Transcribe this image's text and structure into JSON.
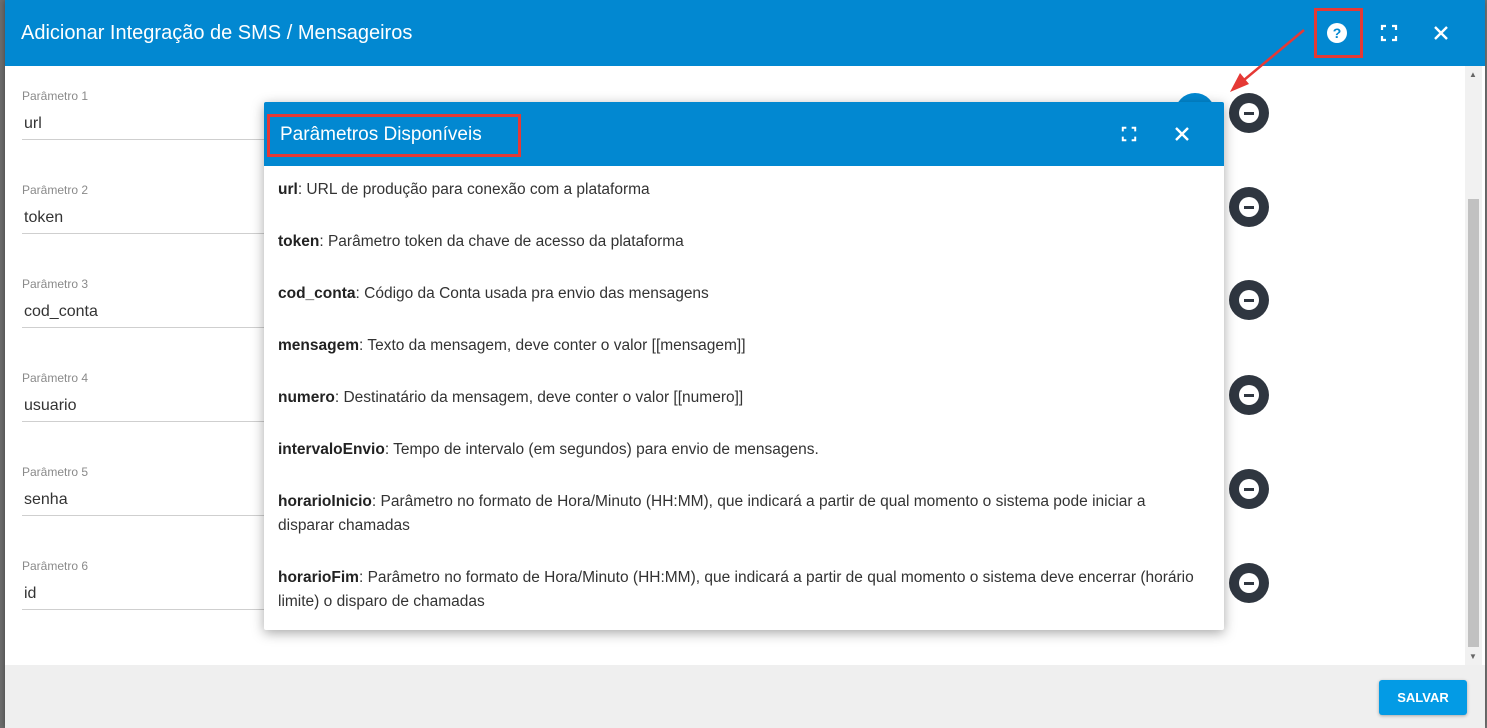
{
  "dialog": {
    "title": "Adicionar Integração de SMS / Mensageiros",
    "help_icon": "help-circle-icon",
    "maximize_icon": "fullscreen-icon",
    "close_icon": "close-icon"
  },
  "parameters": [
    {
      "label": "Parâmetro 1",
      "value": "url"
    },
    {
      "label": "Parâmetro 2",
      "value": "token"
    },
    {
      "label": "Parâmetro 3",
      "value": "cod_conta"
    },
    {
      "label": "Parâmetro 4",
      "value": "usuario"
    },
    {
      "label": "Parâmetro 5",
      "value": "senha"
    },
    {
      "label": "Parâmetro 6",
      "value": "id"
    }
  ],
  "remove_icon": "minus-circle-icon",
  "footer": {
    "save_label": "SALVAR"
  },
  "popup": {
    "title": "Parâmetros Disponíveis",
    "items": [
      {
        "name": "url",
        "desc": ": URL de produção para conexão com a plataforma"
      },
      {
        "name": "token",
        "desc": ": Parâmetro token da chave de acesso da plataforma"
      },
      {
        "name": "cod_conta",
        "desc": ": Código da Conta usada pra envio das mensagens"
      },
      {
        "name": "mensagem",
        "desc": ": Texto da mensagem, deve conter o valor [[mensagem]]"
      },
      {
        "name": "numero",
        "desc": ": Destinatário da mensagem, deve conter o valor [[numero]]"
      },
      {
        "name": "intervaloEnvio",
        "desc": ": Tempo de intervalo (em segundos) para envio de mensagens."
      },
      {
        "name": "horarioInicio",
        "desc": ": Parâmetro no formato de Hora/Minuto (HH:MM), que indicará a partir de qual momento o sistema pode iniciar a disparar chamadas"
      },
      {
        "name": "horarioFim",
        "desc": ": Parâmetro no formato de Hora/Minuto (HH:MM), que indicará a partir de qual momento o sistema deve encerrar (horário limite) o disparo de chamadas"
      }
    ]
  },
  "colors": {
    "header": "#0288d1",
    "highlight": "#e53935",
    "save_button": "#039be5",
    "remove_button": "#2f3640"
  }
}
